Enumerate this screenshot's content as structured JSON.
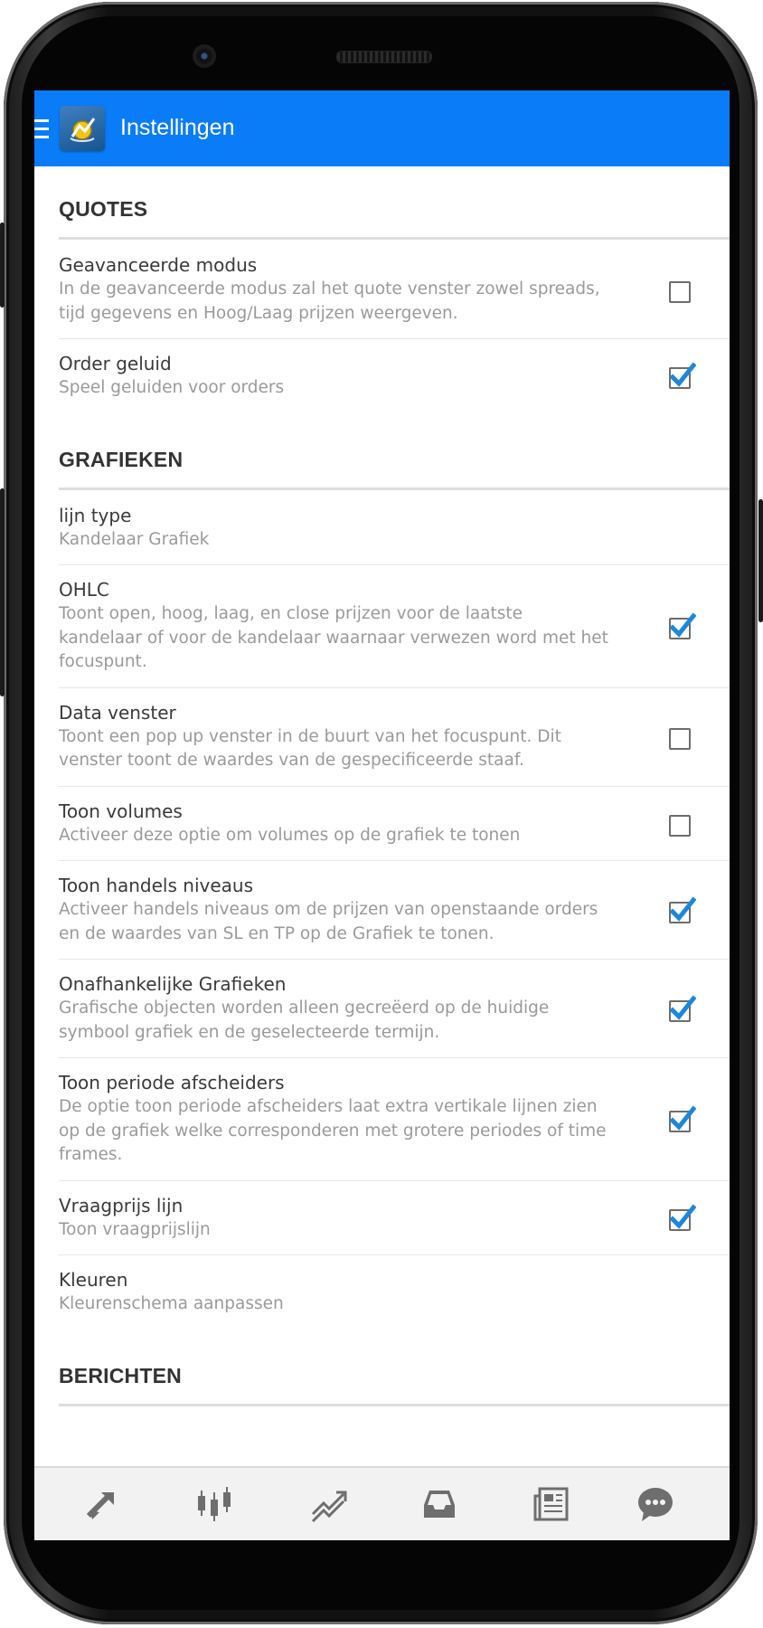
{
  "app": {
    "title": "Instellingen",
    "colors": {
      "appbar": "#0a7cf7",
      "checkbox_tick": "#1e88d8"
    }
  },
  "sections": [
    {
      "header": "QUOTES",
      "items": [
        {
          "title": "Geavanceerde modus",
          "description": [
            "In de geavanceerde modus zal het quote venster zowel spreads,",
            "tijd gegevens en Hoog/Laag prijzen weergeven."
          ],
          "checked": false
        },
        {
          "title": "Order geluid",
          "description": [
            "Speel geluiden voor orders"
          ],
          "checked": true
        }
      ]
    },
    {
      "header": "GRAFIEKEN",
      "items": [
        {
          "title": "lijn type",
          "description": [
            "Kandelaar Grafiek"
          ],
          "checked": null
        },
        {
          "title": "OHLC",
          "description": [
            "Toont open, hoog, laag, en close prijzen voor de laatste",
            "kandelaar of voor de kandelaar waarnaar verwezen word met het",
            "focuspunt."
          ],
          "checked": true
        },
        {
          "title": "Data venster",
          "description": [
            "Toont een pop up venster in de buurt van het focuspunt. Dit",
            "venster toont de waardes van de gespecificeerde staaf."
          ],
          "checked": false
        },
        {
          "title": "Toon volumes",
          "description": [
            "Activeer deze optie om volumes op de grafiek te tonen"
          ],
          "checked": false
        },
        {
          "title": "Toon handels niveaus",
          "description": [
            "Activeer handels niveaus om de prijzen van openstaande orders",
            "en de waardes van SL en TP op de Grafiek te tonen."
          ],
          "checked": true
        },
        {
          "title": "Onafhankelijke Grafieken",
          "description": [
            "Grafische objecten worden alleen gecreëerd op de huidige",
            "symbool grafiek en de geselecteerde termijn."
          ],
          "checked": true
        },
        {
          "title": "Toon periode afscheiders",
          "description": [
            "De optie toon periode afscheiders laat extra vertikale lijnen zien",
            "op de grafiek welke corresponderen met grotere periodes of time",
            "frames."
          ],
          "checked": true
        },
        {
          "title": "Vraagprijs lijn",
          "description": [
            "Toon vraagprijslijn"
          ],
          "checked": true
        },
        {
          "title": "Kleuren",
          "description": [
            "Kleurenschema aanpassen"
          ],
          "checked": null
        }
      ]
    },
    {
      "header": "BERICHTEN",
      "items": []
    }
  ],
  "bottom_nav": [
    {
      "icon": "quotes-arrows-icon"
    },
    {
      "icon": "candlestick-chart-icon"
    },
    {
      "icon": "trade-lines-icon"
    },
    {
      "icon": "inbox-tray-icon"
    },
    {
      "icon": "news-icon"
    },
    {
      "icon": "chat-bubble-icon"
    }
  ]
}
